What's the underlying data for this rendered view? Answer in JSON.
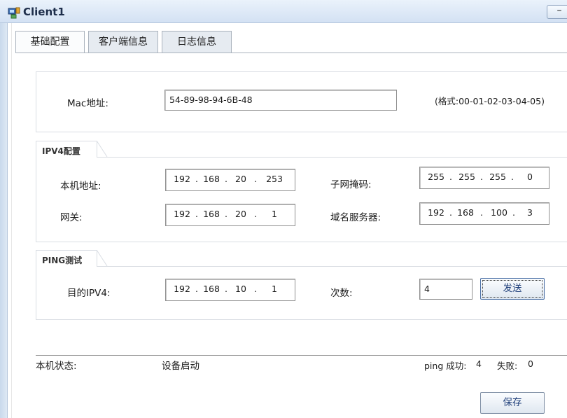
{
  "window": {
    "title": "Client1",
    "minimize_glyph": "–"
  },
  "tabs": [
    {
      "label": "基础配置",
      "active": true
    },
    {
      "label": "客户端信息",
      "active": false
    },
    {
      "label": "日志信息",
      "active": false
    }
  ],
  "mac": {
    "label": "Mac地址:",
    "value": "54-89-98-94-6B-48",
    "hint": "(格式:00-01-02-03-04-05)"
  },
  "ipv4": {
    "section_title": "IPV4配置",
    "local_addr_label": "本机地址:",
    "local_addr": [
      "192",
      "168",
      "20",
      "253"
    ],
    "mask_label": "子网掩码:",
    "mask": [
      "255",
      "255",
      "255",
      "0"
    ],
    "gateway_label": "网关:",
    "gateway": [
      "192",
      "168",
      "20",
      "1"
    ],
    "dns_label": "域名服务器:",
    "dns": [
      "192",
      "168",
      "100",
      "3"
    ]
  },
  "ping": {
    "section_title": "PING测试",
    "target_label": "目的IPV4:",
    "target": [
      "192",
      "168",
      "10",
      "1"
    ],
    "count_label": "次数:",
    "count": "4",
    "send_button": "发送"
  },
  "status": {
    "label": "本机状态:",
    "value": "设备启动",
    "ping_success_label": "ping 成功:",
    "ping_success": "4",
    "fail_label": "失败:",
    "fail": "0"
  },
  "footer": {
    "save_button": "保存"
  }
}
